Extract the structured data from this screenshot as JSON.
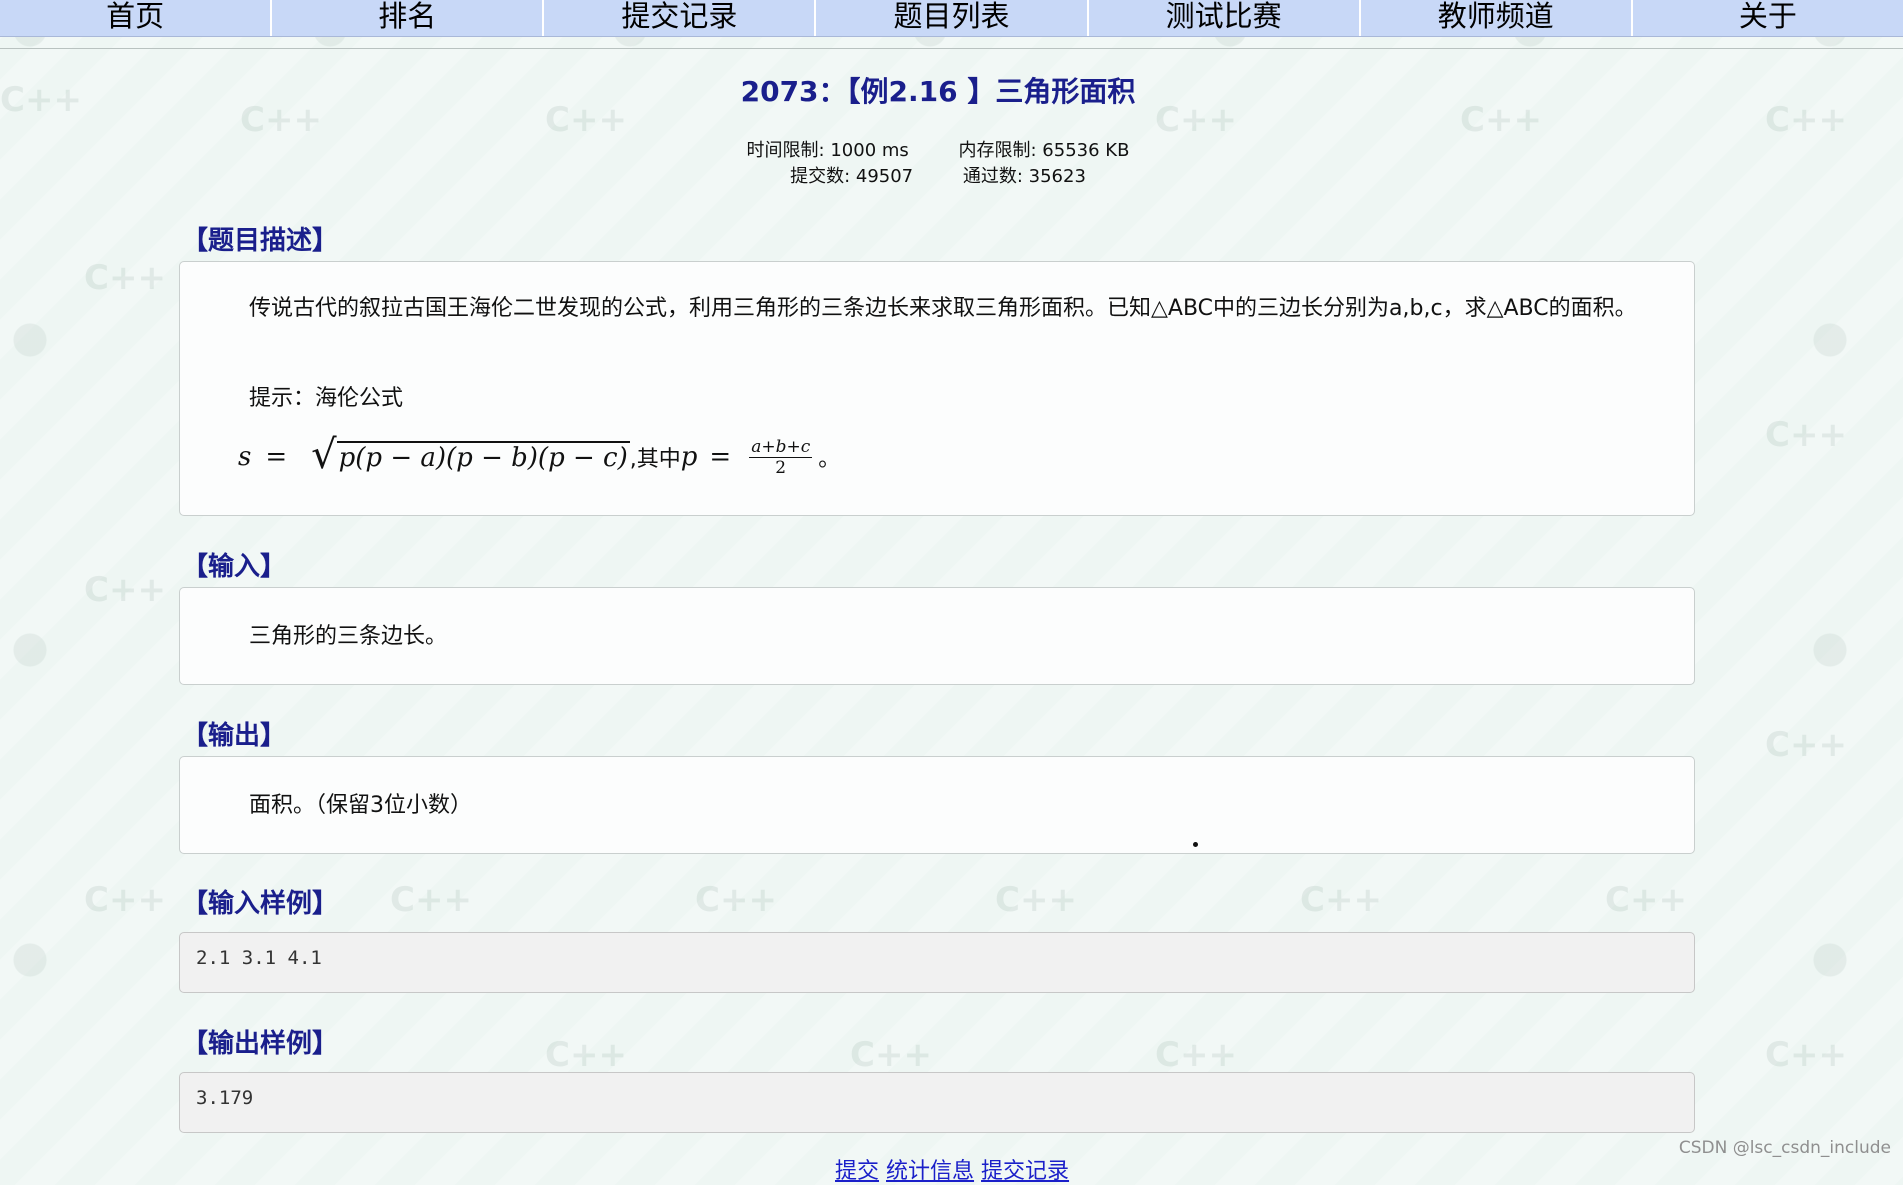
{
  "nav": [
    "首页",
    "排名",
    "提交记录",
    "题目列表",
    "测试比赛",
    "教师频道",
    "关于"
  ],
  "problem": {
    "title": "2073：【例2.16 】三角形面积",
    "time_limit": "时间限制: 1000 ms",
    "memory_limit": "内存限制: 65536 KB",
    "submit_count": "提交数: 49507",
    "pass_count": "通过数: 35623"
  },
  "sections": {
    "description": {
      "heading": "【题目描述】",
      "paragraph1": "传说古代的叙拉古国王海伦二世发现的公式，利用三角形的三条边长来求取三角形面积。已知△ABC中的三边长分别为a,b,c，求△ABC的面积。",
      "hint": "提示：海伦公式",
      "formula_lhs": "s",
      "formula_eq": "=",
      "formula_sqrt": "p(p − a)(p − b)(p − c)",
      "formula_mid": ",其中",
      "formula_p": "p",
      "formula_num": "a+b+c",
      "formula_den": "2",
      "formula_end": "。"
    },
    "input": {
      "heading": "【输入】",
      "text": "三角形的三条边长。"
    },
    "output": {
      "heading": "【输出】",
      "text": "面积。（保留3位小数）"
    },
    "sample_input": {
      "heading": "【输入样例】",
      "text": "2.1 3.1 4.1"
    },
    "sample_output": {
      "heading": "【输出样例】",
      "text": "3.179"
    }
  },
  "bottom_links": [
    "提交",
    "统计信息",
    "提交记录"
  ],
  "credit": "CSDN @lsc_csdn_include",
  "colors": {
    "nav_bg": "#c8d8f7",
    "heading": "#1a1f8c",
    "link": "#1a1fc9"
  }
}
